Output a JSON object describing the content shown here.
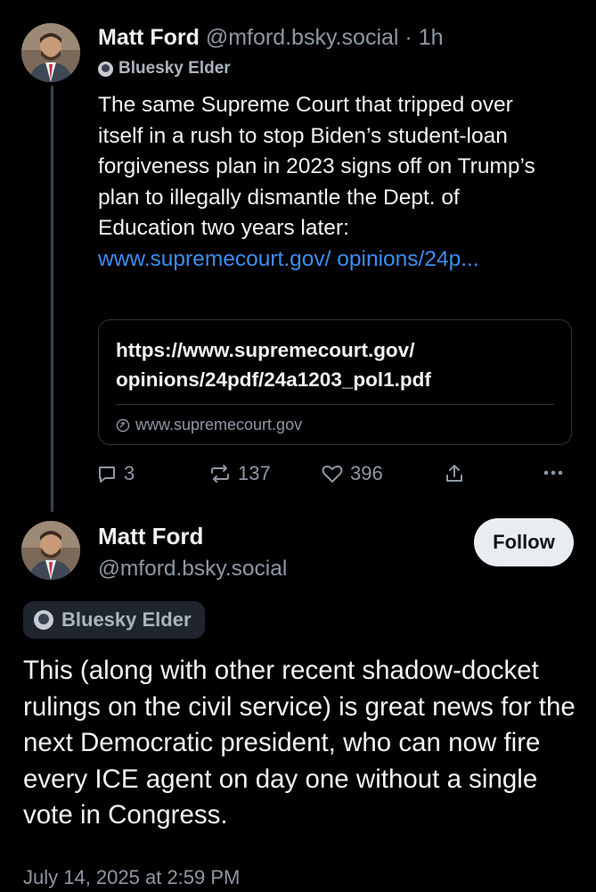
{
  "post1": {
    "author_name": "Matt Ford",
    "author_handle": "@mford.bsky.social",
    "separator": "·",
    "time_ago": "1h",
    "badge": "Bluesky Elder",
    "text": "The same Supreme Court that tripped over itself in a rush to stop Biden’s student-loan forgiveness plan in 2023 signs off on Trump’s plan to illegally dismantle the Dept. of Education two years later: ",
    "link_text": "www.supremecourt.gov/ opinions/24p...",
    "link_card": {
      "title": "https://www.supremecourt.gov/ opinions/24pdf/24a1203_pol1.pdf",
      "domain": "www.supremecourt.gov"
    },
    "actions": {
      "replies": "3",
      "reposts": "137",
      "likes": "396"
    }
  },
  "post2": {
    "author_name": "Matt Ford",
    "author_handle": "@mford.bsky.social",
    "follow_label": "Follow",
    "badge": "Bluesky Elder",
    "text": "This (along with other recent shadow-docket rulings on the civil service) is great news for the next Democratic president, who can now fire every ICE agent on day one without a single vote in Congress.",
    "timestamp": "July 14, 2025 at 2:59 PM"
  },
  "colors": {
    "background": "#000000",
    "text": "#f1f3f5",
    "muted": "#8d98a5",
    "link": "#3b8ef0",
    "border": "#2d3540",
    "follow_bg": "#e9edf1"
  },
  "icons": [
    "reply-icon",
    "repost-icon",
    "like-icon",
    "share-icon",
    "more-icon",
    "globe-icon",
    "elder-badge-icon"
  ]
}
